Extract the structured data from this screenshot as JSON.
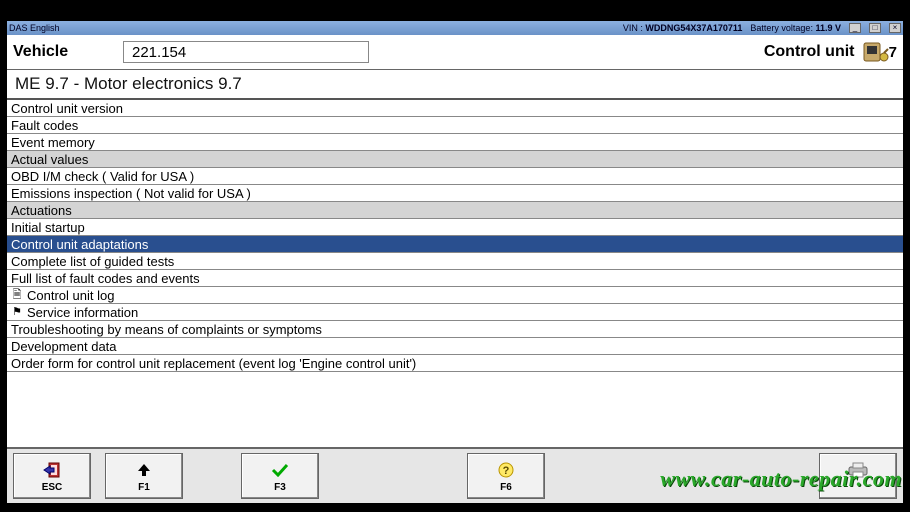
{
  "titlebar": {
    "app": "DAS English",
    "vin_label": "VIN :",
    "vin": "WDDNG54X37A170711",
    "battery_label": "Battery voltage:",
    "battery": "11.9 V"
  },
  "header": {
    "vehicle_label": "Vehicle",
    "vehicle_value": "221.154",
    "cu_label": "Control unit",
    "cu_value": ".7"
  },
  "subtitle": "ME 9.7 - Motor electronics 9.7",
  "rows": [
    {
      "label": "Control unit version",
      "type": "item"
    },
    {
      "label": "Fault codes",
      "type": "item"
    },
    {
      "label": "Event memory",
      "type": "item"
    },
    {
      "label": "Actual values",
      "type": "cat"
    },
    {
      "label": "OBD I/M check ( Valid for USA )",
      "type": "item"
    },
    {
      "label": "Emissions inspection ( Not valid for USA )",
      "type": "item"
    },
    {
      "label": "Actuations",
      "type": "cat"
    },
    {
      "label": "Initial startup",
      "type": "item"
    },
    {
      "label": "Control unit adaptations",
      "type": "sel"
    },
    {
      "label": "Complete list of guided tests",
      "type": "item"
    },
    {
      "label": "Full list of fault codes and events",
      "type": "item"
    },
    {
      "label": "Control unit log",
      "type": "item",
      "icon": "doc"
    },
    {
      "label": "Service information",
      "type": "item",
      "icon": "flag"
    },
    {
      "label": "Troubleshooting by means of complaints or symptoms",
      "type": "item"
    },
    {
      "label": "Development data",
      "type": "item"
    },
    {
      "label": "Order form for control unit replacement (event log 'Engine control unit')",
      "type": "item"
    }
  ],
  "footer": {
    "esc": "ESC",
    "f1": "F1",
    "f3": "F3",
    "f6": "F6"
  },
  "watermark": "www.car-auto-repair.com"
}
